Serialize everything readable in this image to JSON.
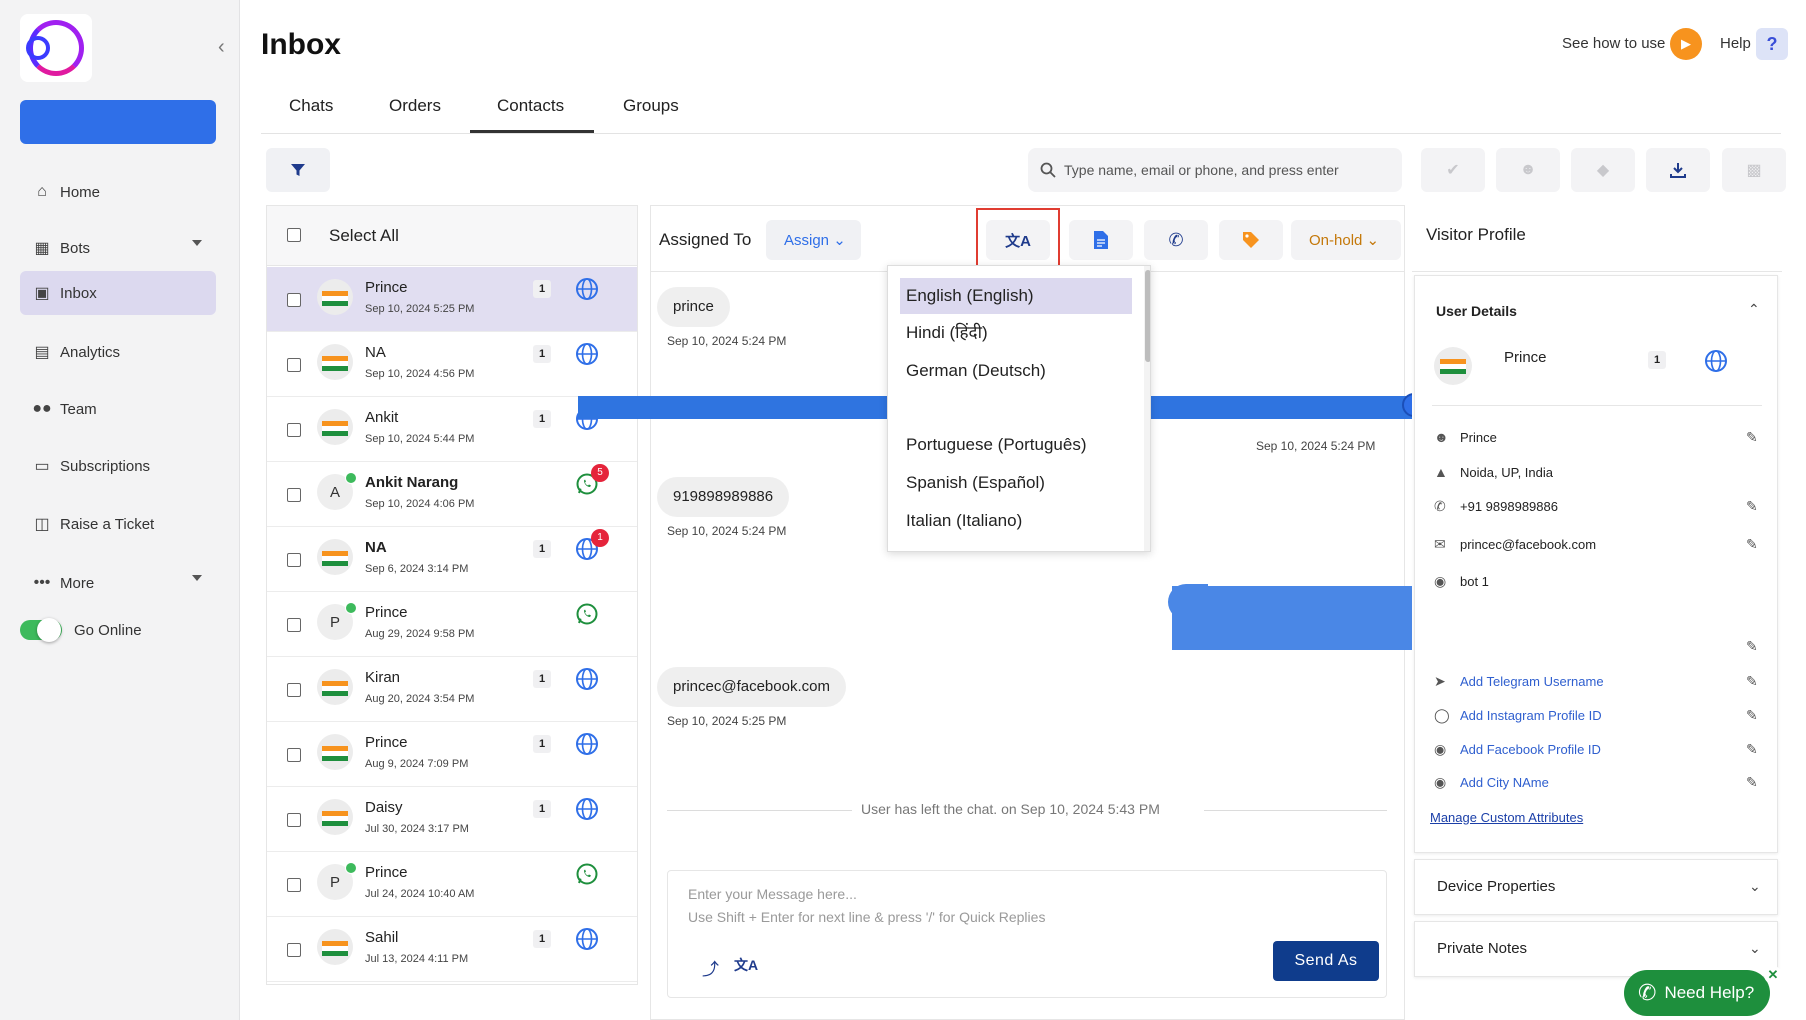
{
  "sidebar": {
    "items": [
      {
        "label": "Home",
        "icon": "home-icon"
      },
      {
        "label": "Bots",
        "icon": "bots-icon"
      },
      {
        "label": "Inbox",
        "icon": "inbox-icon"
      },
      {
        "label": "Analytics",
        "icon": "analytics-icon"
      },
      {
        "label": "Team",
        "icon": "team-icon"
      },
      {
        "label": "Subscriptions",
        "icon": "subscriptions-icon"
      },
      {
        "label": "Raise a Ticket",
        "icon": "ticket-icon"
      },
      {
        "label": "More",
        "icon": "more-icon"
      }
    ],
    "online_toggle_label": "Go Online",
    "online": true
  },
  "header": {
    "title": "Inbox",
    "see_how": "See how to use",
    "help": "Help",
    "help_q": "?"
  },
  "tabs": [
    {
      "label": "Chats"
    },
    {
      "label": "Orders"
    },
    {
      "label": "Contacts",
      "active": true
    },
    {
      "label": "Groups"
    }
  ],
  "search": {
    "placeholder": "Type name, email or phone, and press enter"
  },
  "contacts": {
    "select_all": "Select All",
    "rows": [
      {
        "name": "Prince",
        "time": "Sep 10, 2024 5:25 PM",
        "badge": "1",
        "channel": "web",
        "avatar": "flag"
      },
      {
        "name": "NA",
        "time": "Sep 10, 2024 4:56 PM",
        "badge": "1",
        "channel": "web",
        "avatar": "flag"
      },
      {
        "name": "Ankit",
        "time": "Sep 10, 2024 5:44 PM",
        "badge": "1",
        "channel": "web",
        "avatar": "flag"
      },
      {
        "name": "Ankit Narang",
        "time": "Sep 10, 2024 4:06 PM",
        "badge": "",
        "channel": "whatsapp",
        "avatar": "A",
        "unread": "5"
      },
      {
        "name": "NA",
        "time": "Sep 6, 2024 3:14 PM",
        "badge": "1",
        "channel": "web",
        "avatar": "flag",
        "unread": "1"
      },
      {
        "name": "Prince",
        "time": "Aug 29, 2024 9:58 PM",
        "badge": "",
        "channel": "whatsapp",
        "avatar": "P"
      },
      {
        "name": "Kiran",
        "time": "Aug 20, 2024 3:54 PM",
        "badge": "1",
        "channel": "web",
        "avatar": "flag"
      },
      {
        "name": "Prince",
        "time": "Aug 9, 2024 7:09 PM",
        "badge": "1",
        "channel": "web",
        "avatar": "flag"
      },
      {
        "name": "Daisy",
        "time": "Jul 30, 2024 3:17 PM",
        "badge": "1",
        "channel": "web",
        "avatar": "flag"
      },
      {
        "name": "Prince",
        "time": "Jul 24, 2024 10:40 AM",
        "badge": "",
        "channel": "whatsapp",
        "avatar": "P"
      },
      {
        "name": "Sahil",
        "time": "Jul 13, 2024 4:11 PM",
        "badge": "1",
        "channel": "web",
        "avatar": "flag"
      }
    ]
  },
  "chat": {
    "assigned_to": "Assigned To",
    "assign": "Assign",
    "status": "On-hold",
    "messages": [
      {
        "text": "prince",
        "time": "Sep 10, 2024 5:24 PM"
      },
      {
        "text": "919898989886",
        "time": "Sep 10, 2024 5:24 PM"
      },
      {
        "text": "princec@facebook.com",
        "time": "Sep 10, 2024 5:25 PM"
      }
    ],
    "reply_time": "Sep 10, 2024 5:24 PM",
    "system_message": "User has left the chat. on  Sep 10, 2024 5:43 PM",
    "composer_placeholder": "Enter your Message here...\nUse Shift + Enter for next line & press '/' for Quick Replies",
    "send_as": "Send As"
  },
  "language_dropdown": {
    "options": [
      {
        "label": "English (English)"
      },
      {
        "label": "Hindi (हिंदी)"
      },
      {
        "label": "German (Deutsch)"
      },
      {
        "label": "Portuguese (Português)"
      },
      {
        "label": "Spanish (Español)"
      },
      {
        "label": "Italian (Italiano)"
      }
    ]
  },
  "profile": {
    "title": "Visitor Profile",
    "user_details": "User Details",
    "name": "Prince",
    "badge": "1",
    "fields": [
      {
        "icon": "person-icon",
        "value": "Prince"
      },
      {
        "icon": "location-icon",
        "value": "Noida, UP, India"
      },
      {
        "icon": "phone-icon",
        "value": "+91 9898989886"
      },
      {
        "icon": "email-icon",
        "value": "princec@facebook.com"
      },
      {
        "icon": "bot-icon",
        "value": "bot 1"
      }
    ],
    "links": [
      {
        "icon": "telegram-icon",
        "value": "Add Telegram Username"
      },
      {
        "icon": "instagram-icon",
        "value": "Add Instagram Profile ID"
      },
      {
        "icon": "facebook-icon",
        "value": "Add Facebook Profile ID"
      },
      {
        "icon": "city-icon",
        "value": "Add City NAme"
      }
    ],
    "manage": "Manage Custom Attributes",
    "device_properties": "Device Properties",
    "private_notes": "Private Notes"
  },
  "need_help": "Need Help?",
  "colors": {
    "accent": "#2f6fe8",
    "active_bg": "#dcd9ef",
    "send_btn": "#0f3c8c",
    "whatsapp": "#1e8f3d"
  }
}
